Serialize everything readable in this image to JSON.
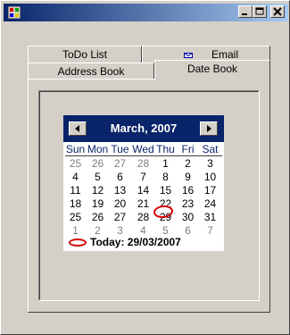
{
  "window": {
    "title": "",
    "titlebar_colors": [
      "#0a246a",
      "#a6caf0"
    ]
  },
  "tabs": {
    "row1": [
      {
        "label": "ToDo List"
      },
      {
        "label": "Email",
        "icon": "envelope-icon"
      }
    ],
    "row2": [
      {
        "label": "Address Book"
      },
      {
        "label": "Date Book",
        "selected": true
      }
    ]
  },
  "calendar": {
    "month_title": "March, 2007",
    "days_of_week": [
      "Sun",
      "Mon",
      "Tue",
      "Wed",
      "Thu",
      "Fri",
      "Sat"
    ],
    "weeks": [
      [
        "25",
        "26",
        "27",
        "28",
        "1",
        "2",
        "3"
      ],
      [
        "4",
        "5",
        "6",
        "7",
        "8",
        "9",
        "10"
      ],
      [
        "11",
        "12",
        "13",
        "14",
        "15",
        "16",
        "17"
      ],
      [
        "18",
        "19",
        "20",
        "21",
        "22",
        "23",
        "24"
      ],
      [
        "25",
        "26",
        "27",
        "28",
        "29",
        "30",
        "31"
      ],
      [
        "1",
        "2",
        "3",
        "4",
        "5",
        "6",
        "7"
      ]
    ],
    "trailing_days": {
      "week_0": [
        0,
        1,
        2,
        3
      ],
      "week_5": [
        0,
        1,
        2,
        3,
        4,
        5,
        6
      ]
    },
    "today_label": "Today: 29/03/2007",
    "highlight_color": "#d40000",
    "header_color": "#0a246a"
  }
}
